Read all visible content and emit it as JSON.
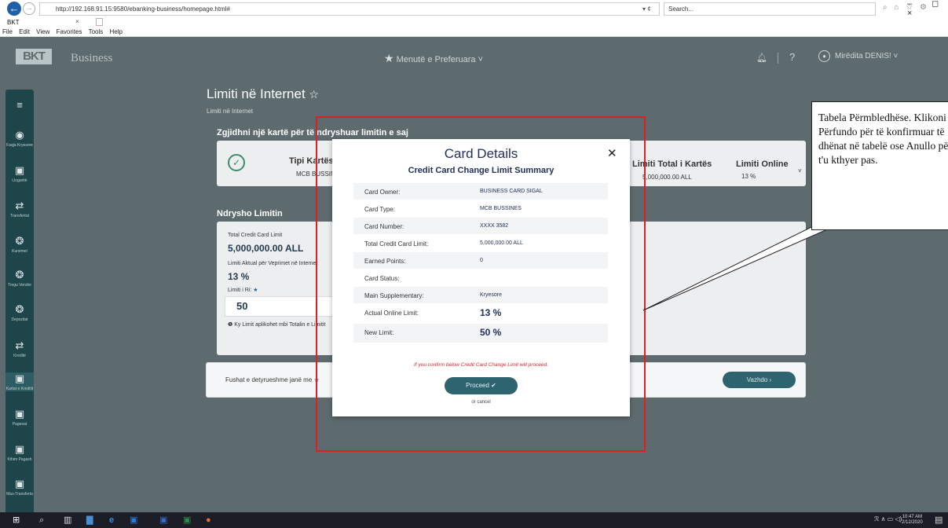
{
  "browser": {
    "url": "http://192.168.91.15:9580/ebanking-business/homepage.html#",
    "refresh": "▾ ¢",
    "search_placeholder": "Search...",
    "tab_title": "BKT",
    "tab_close": "×",
    "menu": [
      "File",
      "Edit",
      "View",
      "Favorites",
      "Tools",
      "Help"
    ],
    "window_controls": "– ◻ ×"
  },
  "header": {
    "logo": "BKT",
    "logo_subtitle": "Business",
    "preferences": "Menutë e Preferuara",
    "user": "Mirëdita DENIS!"
  },
  "sidebar": {
    "items": [
      {
        "label": "",
        "icon": "menu-icon"
      },
      {
        "label": "Faqja Kryesore",
        "icon": "home-icon"
      },
      {
        "label": "Llogaritë",
        "icon": "accounts-icon"
      },
      {
        "label": "Transfertat",
        "icon": "transfer-icon"
      },
      {
        "label": "Kursimet",
        "icon": "savings-icon"
      },
      {
        "label": "Tregu Vendor",
        "icon": "market-icon"
      },
      {
        "label": "Depozitat",
        "icon": "deposit-icon"
      },
      {
        "label": "Kreditë",
        "icon": "credit-icon"
      },
      {
        "label": "Kartat e Kreditit",
        "icon": "card-icon"
      },
      {
        "label": "Pagesat",
        "icon": "payments-icon"
      },
      {
        "label": "Kthim Pagash",
        "icon": "payroll-icon"
      },
      {
        "label": "Mas-Transferta",
        "icon": "mass-transfer-icon"
      }
    ]
  },
  "page": {
    "title": "Limiti në Internet",
    "subtitle": "Limiti në Internet",
    "select_card_heading": "Zgjidhni një kartë për të ndryshuar limitin e saj",
    "card_type_header": "Tipi Kartës",
    "card_type_value": "MCB BUSSINES",
    "total_limit_header": "Limiti Total i Kartës",
    "total_limit_value": "5,000,000.00 ALL",
    "online_limit_header": "Limiti Online",
    "online_limit_value": "13 %",
    "change_limit_heading": "Ndrysho Limitin",
    "total_credit_label": "Total Credit Card Limit",
    "total_credit_value": "5,000,000.00 ALL",
    "actual_limit_label": "Limiti Aktual për Veprimet në Internet",
    "actual_limit_value": "13 %",
    "new_limit_label": "Limiti i Ri:",
    "new_limit_value": "50",
    "note": "Ky Limit aplikohet mbi Totalin e Limitit",
    "required_fields": "Fushat e detyrueshme janë me",
    "continue_button": "Vazhdo ›"
  },
  "modal": {
    "title": "Card Details",
    "subtitle": "Credit Card Change Limit Summary",
    "rows": [
      {
        "label": "Card Owner:",
        "value": "BUSINESS CARD SIGAL"
      },
      {
        "label": "Card Type:",
        "value": "MCB BUSSINES"
      },
      {
        "label": "Card Number:",
        "value": "XXXX 3582"
      },
      {
        "label": "Total Credit Card Limit:",
        "value": "5,000,000.00 ALL"
      },
      {
        "label": "Earned Points:",
        "value": "0"
      },
      {
        "label": "Card Status:",
        "value": ""
      },
      {
        "label": "Main Supplementary:",
        "value": "Kryesore"
      },
      {
        "label": "Actual Online Limit:",
        "value": "13 %"
      },
      {
        "label": "New Limit:",
        "value": "50 %"
      }
    ],
    "warning": "If you confirm below Credit Card Change Limit will proceed.",
    "proceed": "Proceed ✔",
    "cancel": "or cancel"
  },
  "callout": {
    "text": "Tabela Përmbledhëse. Klikoni Përfundo për të konfirmuar të dhënat në tabelë ose Anullo për t'u kthyer pas."
  },
  "taskbar": {
    "time": "10:47 AM",
    "date": "2/12/2020"
  },
  "colors": {
    "header_bg": "#5d6b6e",
    "sidebar_bg": "#1e4549",
    "accent": "#2e6470",
    "highlight": "#e02020"
  }
}
